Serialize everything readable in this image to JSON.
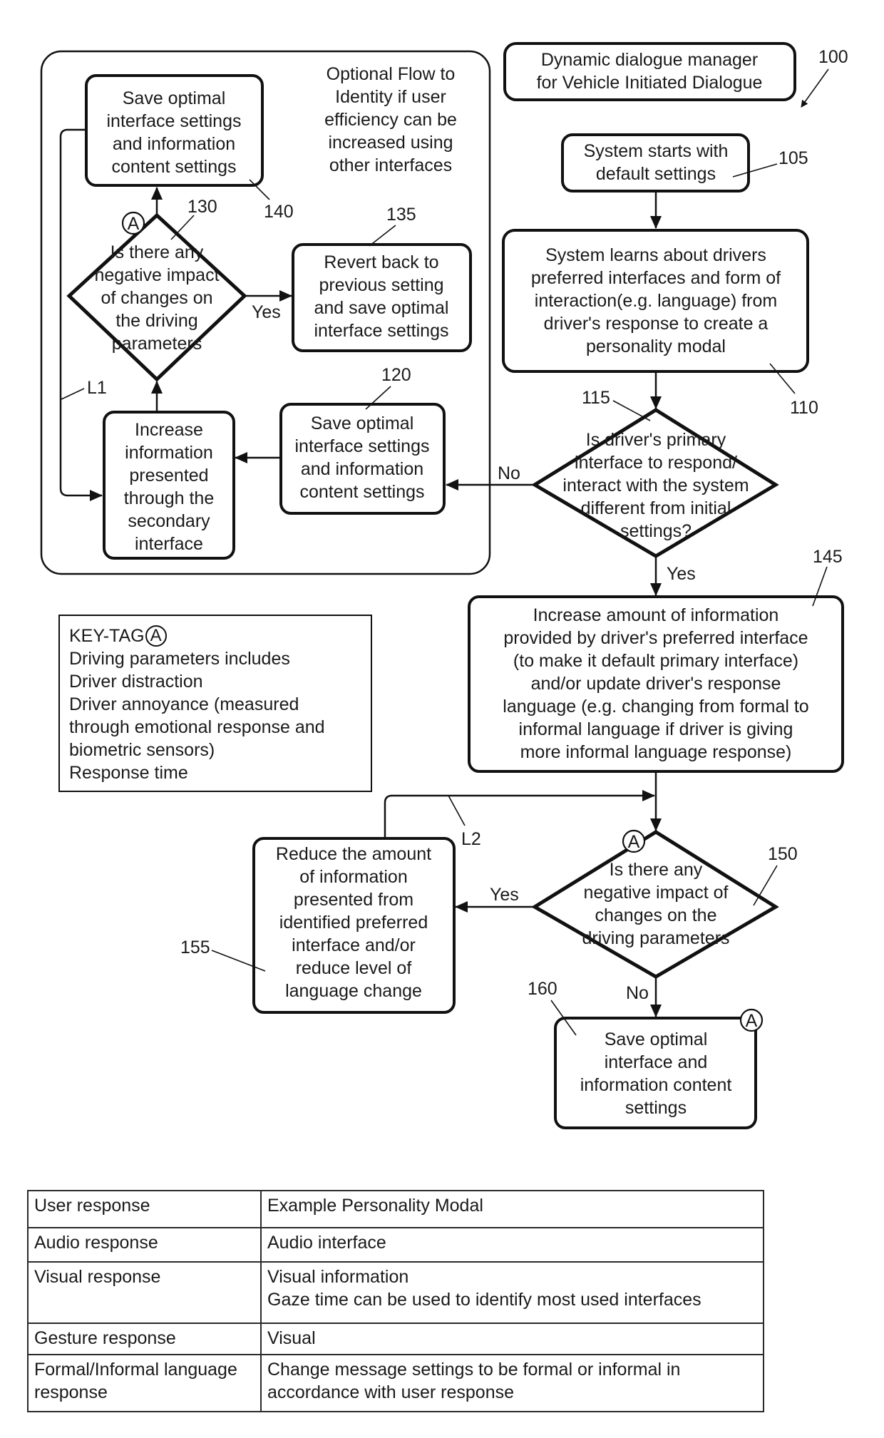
{
  "title_box": {
    "line1": "Dynamic dialogue manager",
    "line2": "for Vehicle Initiated Dialogue",
    "ref": "100"
  },
  "optional_flow": {
    "caption": [
      "Optional Flow to",
      "Identity if user",
      "efficiency can be",
      "increased using",
      "other interfaces"
    ],
    "loop_label": "L1"
  },
  "nodes": {
    "n105": {
      "ref": "105",
      "lines": [
        "System starts with",
        "default settings"
      ]
    },
    "n110": {
      "ref": "110",
      "lines": [
        "System learns about drivers",
        "preferred interfaces and form of",
        "interaction(e.g. language) from",
        "driver's response to create a",
        "personality modal"
      ]
    },
    "n115": {
      "ref": "115",
      "lines": [
        "Is driver's primary",
        "interface to respond/",
        "interact with the system",
        "different from initial",
        "settings?"
      ],
      "no_label": "No",
      "yes_label": "Yes"
    },
    "n120": {
      "ref": "120",
      "lines": [
        "Save optimal",
        "interface settings",
        "and information",
        "content settings"
      ]
    },
    "n125": {
      "lines": [
        "Increase",
        "information",
        "presented",
        "through the",
        "secondary",
        "interface"
      ]
    },
    "n130": {
      "ref": "130",
      "lines": [
        "Is there any",
        "negative impact",
        "of changes on",
        "the driving",
        "parameters"
      ],
      "yes_label": "Yes",
      "tag": "A"
    },
    "n135": {
      "ref": "135",
      "lines": [
        "Revert back to",
        "previous setting",
        "and save optimal",
        "interface settings"
      ]
    },
    "n140": {
      "ref": "140",
      "lines": [
        "Save optimal",
        "interface settings",
        "and information",
        "content settings"
      ]
    },
    "n145": {
      "ref": "145",
      "lines": [
        "Increase amount of information",
        "provided by driver's preferred interface",
        "(to make it default primary interface)",
        "and/or update driver's response",
        "language (e.g. changing from formal to",
        "informal language if driver is giving",
        "more informal language response)"
      ]
    },
    "n150": {
      "ref": "150",
      "lines": [
        "Is there any",
        "negative impact of",
        "changes on the",
        "driving parameters"
      ],
      "yes_label": "Yes",
      "no_label": "No",
      "tag": "A"
    },
    "n155": {
      "ref": "155",
      "lines": [
        "Reduce the amount",
        "of information",
        "presented from",
        "identified preferred",
        "interface and/or",
        "reduce level of",
        "language change"
      ],
      "loop_label": "L2"
    },
    "n160": {
      "ref": "160",
      "lines": [
        "Save optimal",
        "interface and",
        "information content",
        "settings"
      ],
      "tag": "A"
    }
  },
  "key_tag": {
    "title": "KEY-TAG",
    "tag": "A",
    "lines": [
      "Driving parameters includes",
      "Driver distraction",
      "Driver annoyance (measured",
      "through emotional response and",
      "biometric sensors)",
      "Response time"
    ]
  },
  "table": {
    "headers": [
      "User response",
      "Example Personality Modal"
    ],
    "rows": [
      {
        "response": "Audio response",
        "modal": [
          "Audio interface"
        ]
      },
      {
        "response": "Visual response",
        "modal": [
          "Visual information",
          "Gaze time can be used to identify most used interfaces"
        ]
      },
      {
        "response": "Gesture response",
        "modal": [
          "Visual"
        ]
      },
      {
        "response": "Formal/Informal language response",
        "modal": [
          "Change message settings to be formal or informal in",
          "accordance with user response"
        ]
      }
    ]
  }
}
